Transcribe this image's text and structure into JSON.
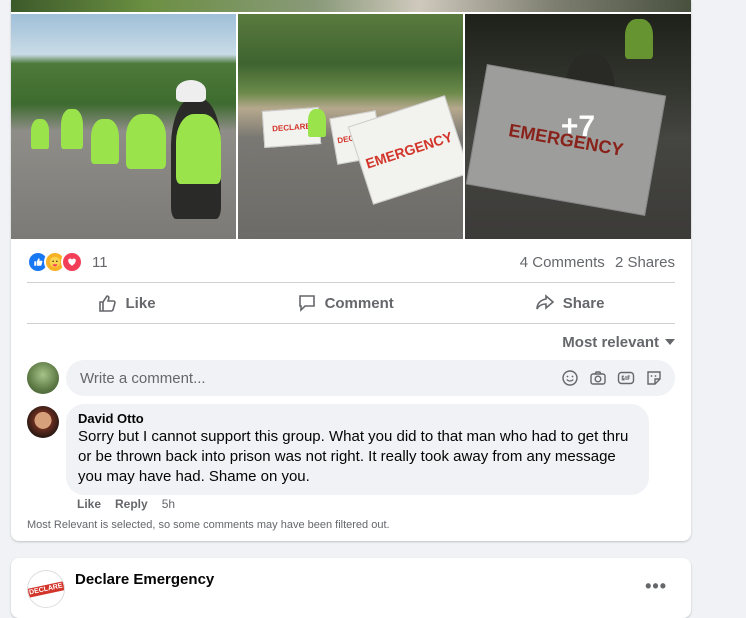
{
  "photos": {
    "more_count": "+7",
    "banner_text_1": "DECLARE",
    "banner_text_2": "EMERGENCY"
  },
  "reactions": {
    "icons": [
      "like-icon",
      "care-icon",
      "love-icon"
    ],
    "count": "11",
    "comments": "4 Comments",
    "shares": "2 Shares"
  },
  "actions": {
    "like": "Like",
    "comment": "Comment",
    "share": "Share"
  },
  "sort": {
    "label": "Most relevant"
  },
  "composer": {
    "placeholder": "Write a comment..."
  },
  "comments": [
    {
      "author": "David Otto",
      "text": "Sorry but I cannot support this group. What you did to that man who had to get thru or be thrown back into prison was not right. It really took away from any message you may have had. Shame on you.",
      "like": "Like",
      "reply": "Reply",
      "time": "5h"
    }
  ],
  "filter_note": "Most Relevant is selected, so some comments may have been filtered out.",
  "next_post": {
    "page_name": "Declare Emergency",
    "logo_text": "DECLARE",
    "more": "•••"
  },
  "colors": {
    "accent": "#1877f2",
    "secondary_text": "#65676b",
    "banner_red": "#d2352a",
    "vest_green": "#9be34b"
  }
}
